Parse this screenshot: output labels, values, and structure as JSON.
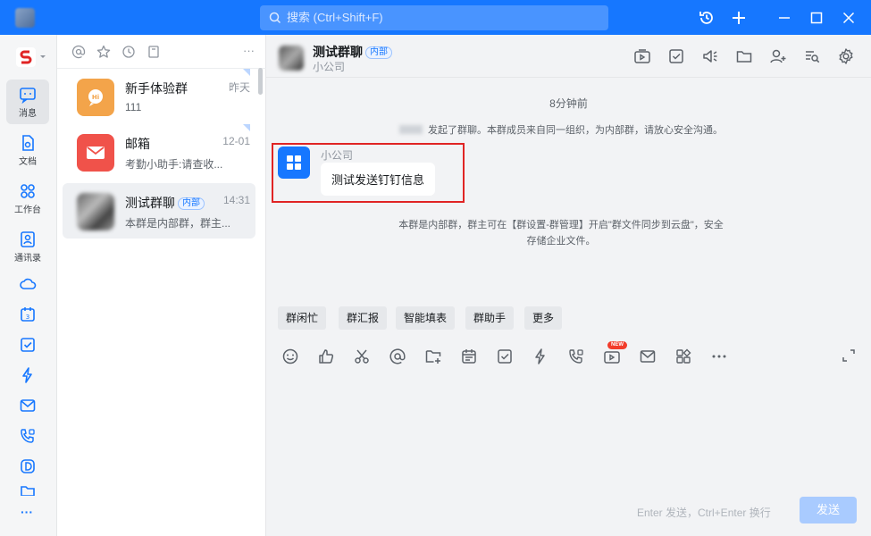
{
  "colors": {
    "brand": "#1677ff",
    "titlebar": "#1677ff",
    "highlight_box": "#e02424",
    "send_disabled": "#a9cbff"
  },
  "titlebar": {
    "search_placeholder": "搜索 (Ctrl+Shift+F)",
    "icons": [
      "history-icon",
      "plus-icon",
      "minimize-icon",
      "maximize-icon",
      "close-icon"
    ]
  },
  "nav": {
    "items": [
      {
        "label": "消息",
        "icon": "message-icon",
        "active": true
      },
      {
        "label": "文档",
        "icon": "document-icon"
      },
      {
        "label": "工作台",
        "icon": "workbench-icon"
      },
      {
        "label": "通讯录",
        "icon": "contacts-icon"
      }
    ],
    "more_icons": [
      "cloud-icon",
      "calendar-icon",
      "todo-icon",
      "ding-icon",
      "mail-icon",
      "video-call-icon",
      "docs-d-icon",
      "folder-icon"
    ],
    "more_label": "···"
  },
  "conversations": [
    {
      "name": "新手体验群",
      "time": "昨天",
      "preview": "111",
      "avatar_color": "#f3a44a"
    },
    {
      "name": "邮箱",
      "time": "12-01",
      "preview": "考勤小助手:请查收...",
      "avatar_color": "#f0524a"
    },
    {
      "name": "测试群聊",
      "tag": "内部",
      "time": "14:31",
      "preview": "本群是内部群，群主...",
      "selected": true
    }
  ],
  "conv_more": "···",
  "chat": {
    "title": "测试群聊",
    "tag": "内部",
    "subtitle": "小公司",
    "time_separator": "8分钟前",
    "sys_msg_1": "发起了群聊。本群成员来自同一组织，为内部群，请放心安全沟通。",
    "message": {
      "sender": "小公司",
      "text": "测试发送钉钉信息"
    },
    "sys_msg_2_line1": "本群是内部群，群主可在【群设置-群管理】开启\"群文件同步到云盘\"，安全",
    "sys_msg_2_line2": "存储企业文件。",
    "quick_actions": [
      "群闲忙",
      "群汇报",
      "智能填表",
      "群助手",
      "更多"
    ],
    "new_badge": "NEW",
    "input_hint": "Enter 发送，Ctrl+Enter 换行",
    "send_label": "发送"
  }
}
